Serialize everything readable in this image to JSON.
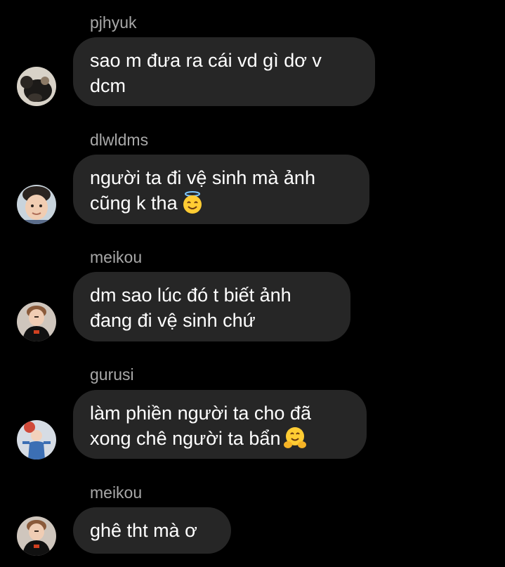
{
  "messages": [
    {
      "sender": "pjhyuk",
      "lines": [
        "sao m đưa ra cái vd gì dơ v",
        "dcm"
      ],
      "avatar_icon": "avatar-photo-dark-plush"
    },
    {
      "sender": "dlwldms",
      "lines": [
        "người ta đi vệ sinh mà ảnh",
        "cũng k tha"
      ],
      "emoji": "smiling-face-with-halo-emoji",
      "avatar_icon": "avatar-photo-child"
    },
    {
      "sender": "meikou",
      "lines": [
        "dm sao lúc đó t biết ảnh",
        "đang đi vệ sinh chứ"
      ],
      "avatar_icon": "avatar-photo-boy-black-shirt"
    },
    {
      "sender": "gurusi",
      "lines": [
        "làm phiền người ta cho đã",
        "xong chê người ta bẩn"
      ],
      "emoji": "hugging-face-emoji",
      "avatar_icon": "avatar-photo-figure-blue"
    },
    {
      "sender": "meikou",
      "lines": [
        "ghê tht mà ơ"
      ],
      "avatar_icon": "avatar-photo-boy-black-shirt"
    }
  ],
  "colors": {
    "background": "#000000",
    "bubble": "#262626",
    "message_text": "#ffffff",
    "sender_text": "#a8a8a8"
  }
}
